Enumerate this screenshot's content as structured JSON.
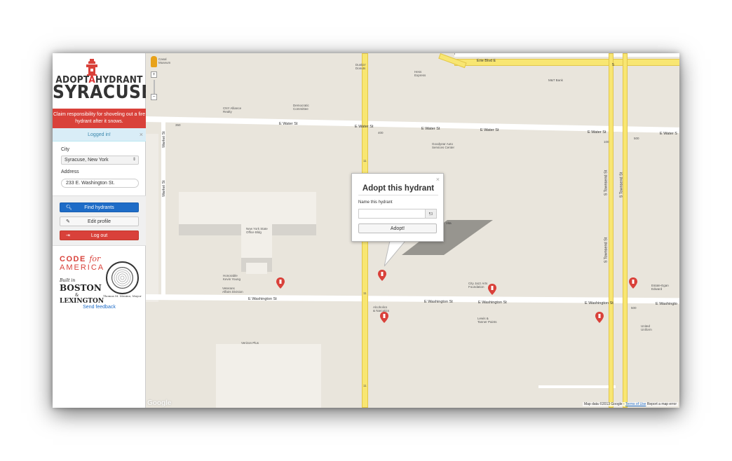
{
  "sidebar": {
    "logo": {
      "line1_a": "ADOPT",
      "line1_b": "A",
      "line1_c": "HYDRANT",
      "line2": "SYRACUSE"
    },
    "banner": "Claim responsibility for shoveling out a fire hydrant after it snows.",
    "alert": {
      "text": "Logged in!",
      "close": "×"
    },
    "city_label": "City",
    "city_value": "Syracuse, New York",
    "address_label": "Address",
    "address_value": "233 E. Washington St.",
    "buttons": {
      "find": "Find hydrants",
      "edit": "Edit profile",
      "logout": "Log out"
    },
    "cfa": {
      "code": "CODE",
      "for": "for",
      "america": "AMERICA"
    },
    "built": {
      "small": "Built in",
      "boston": "BOSTON",
      "amp": "&",
      "lexington": "LEXINGTON"
    },
    "mayor": "Thomas M. Menino, Mayor",
    "feedback": "Send feedback"
  },
  "popup": {
    "close": "×",
    "title": "Adopt this hydrant",
    "name_label": "Name this hydrant",
    "name_value": "",
    "addon": "¶3",
    "adopt": "Adopt!"
  },
  "map": {
    "labels": {
      "erie": "Erie Blvd E",
      "water1": "E Water St",
      "water2": "E Water St",
      "water3": "E Water St",
      "water4": "E Water St",
      "water5": "E Water St",
      "water6": "E Water S",
      "wash1": "E Washington St",
      "wash2": "E Washington St",
      "wash3": "E Washington St",
      "wash4": "E Washington St",
      "wash5": "E Washingto",
      "market1": "Market St",
      "market2": "Market St",
      "townsend1": "S Townsend St",
      "townsend2": "S Townsend St",
      "townsend3": "S Townsend St",
      "dunkin": "Dunkin'\nDonuts",
      "hess": "Hess\nExpress",
      "mt": "M&T Bank",
      "cny": "CNY Alliance\nRealty",
      "democratic": "Democratic\nCommittee",
      "goodyear": "Goodyear Auto\nServices Center",
      "nysob": "New York State\nOffice Bldg",
      "honorable": "Honorable\nKevin Young",
      "veterans": "Veterans\nAffairs Division",
      "alcoholics": "Alcoholics\n& Narcotics",
      "cityjazz": "City Jazz Arts\nFoundation",
      "lewis": "Lewis &\nTanner Paints",
      "estate": "Estate-Egan\nEdward",
      "united": "United\nUniform",
      "verizon": "Verizon Plus",
      "casal": "Casal\nMuseum",
      "vita": "Vita",
      "n350": "350",
      "n400": "400",
      "n500a": "500",
      "n500b": "500",
      "n100": "100",
      "r11a": "11",
      "r11b": "11",
      "r11c": "11",
      "r5": "5",
      "r7": "7"
    },
    "footer_data": "Map data ©2013 Google -",
    "footer_terms": "Terms of Use",
    "footer_report": "Report a map error",
    "google": "Google"
  },
  "colors": {
    "accent_red": "#d9413a",
    "accent_blue": "#1e6cc7",
    "road_yellow": "#f8e672"
  }
}
